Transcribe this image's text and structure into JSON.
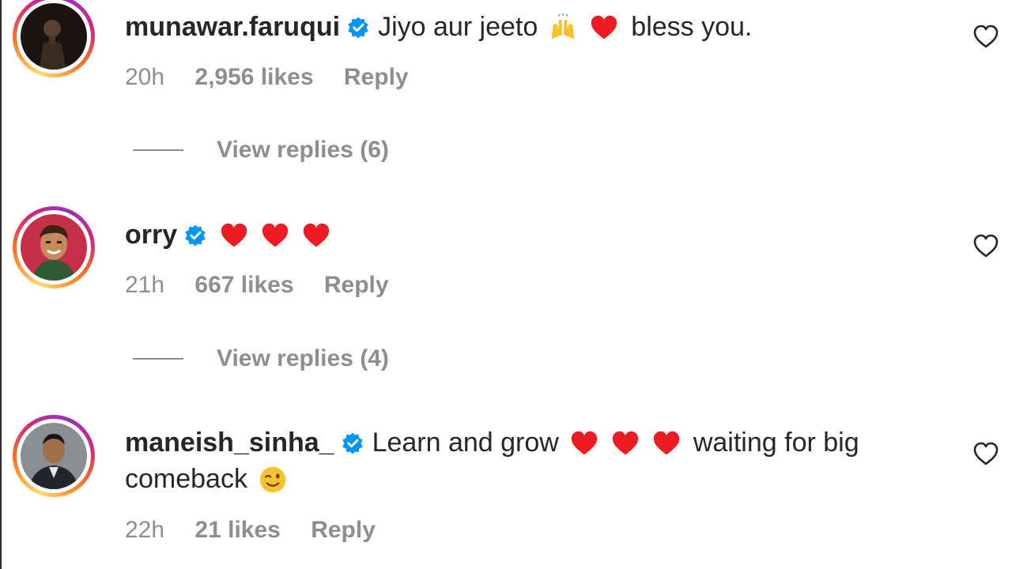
{
  "colors": {
    "verified_blue": "#0095f6",
    "heart_red": "#ed1c24",
    "muted_gray": "#8e8e8e",
    "text_dark": "#262626"
  },
  "comments": [
    {
      "username": "munawar.faruqui",
      "verified": true,
      "text_before": "Jiyo aur jeeto",
      "emojis_mid": [
        "raising-hands-emoji",
        "red-heart-emoji"
      ],
      "text_after": "bless you.",
      "time": "20h",
      "likes": "2,956 likes",
      "reply": "Reply",
      "view_replies": "View replies (6)"
    },
    {
      "username": "orry",
      "verified": true,
      "emojis": [
        "red-heart-emoji",
        "red-heart-emoji",
        "red-heart-emoji"
      ],
      "time": "21h",
      "likes": "667 likes",
      "reply": "Reply",
      "view_replies": "View replies (4)"
    },
    {
      "username": "maneish_sinha_",
      "verified": true,
      "text_before": "Learn and grow",
      "emojis_mid": [
        "red-heart-emoji",
        "red-heart-emoji",
        "red-heart-emoji"
      ],
      "text_after": "waiting for big",
      "text_line2": "comeback",
      "emoji_end": "winking-face-emoji",
      "time": "22h",
      "likes": "21 likes",
      "reply": "Reply"
    }
  ]
}
